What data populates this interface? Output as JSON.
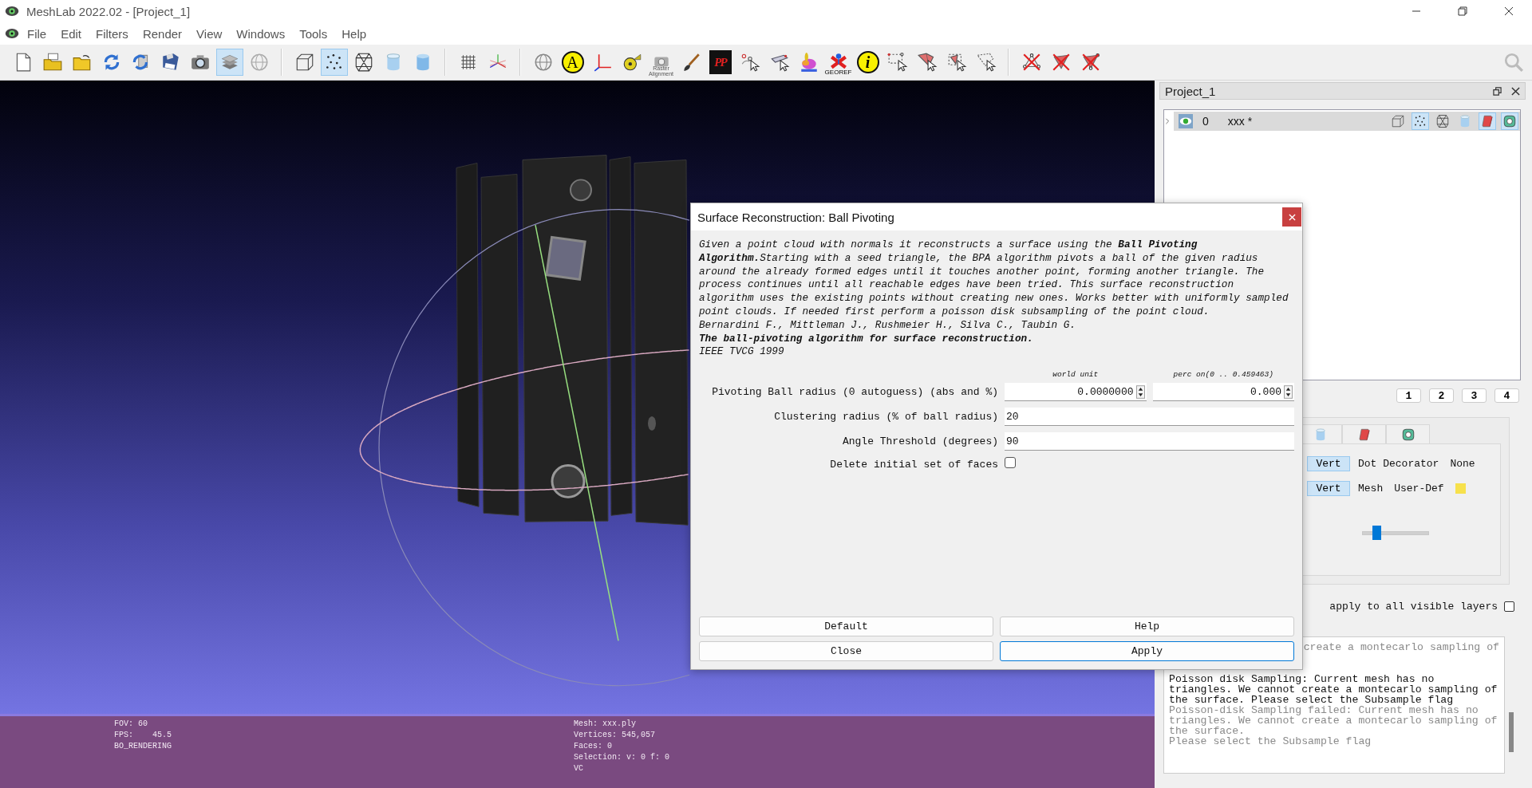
{
  "window": {
    "title": "MeshLab 2022.02 - [Project_1]"
  },
  "menu": [
    "File",
    "Edit",
    "Filters",
    "Render",
    "View",
    "Windows",
    "Tools",
    "Help"
  ],
  "toolbar": [
    [
      {
        "kind": "new-file",
        "selected": false
      },
      {
        "kind": "open-layers",
        "selected": false
      },
      {
        "kind": "open-folder",
        "selected": false
      },
      {
        "kind": "reload",
        "selected": false
      },
      {
        "kind": "reload-all",
        "selected": false
      },
      {
        "kind": "save",
        "selected": false
      },
      {
        "kind": "snapshot",
        "selected": false
      },
      {
        "kind": "layers",
        "selected": true
      },
      {
        "kind": "globe",
        "selected": false
      }
    ],
    [
      {
        "kind": "box",
        "selected": false
      },
      {
        "kind": "points",
        "selected": true
      },
      {
        "kind": "wireframe",
        "selected": false
      },
      {
        "kind": "cylinder",
        "selected": false
      },
      {
        "kind": "cylinder-flat",
        "selected": false
      }
    ],
    [
      {
        "kind": "grid",
        "selected": false
      },
      {
        "kind": "axes",
        "selected": false
      }
    ],
    [
      {
        "kind": "sphere",
        "selected": false
      },
      {
        "kind": "letter",
        "text": "A",
        "selected": false
      },
      {
        "kind": "axes-lines",
        "selected": false
      },
      {
        "kind": "tape",
        "selected": false
      },
      {
        "kind": "raster",
        "text": "Raster Alignment",
        "selected": false
      },
      {
        "kind": "brush",
        "selected": false
      },
      {
        "kind": "pp",
        "text": "PP",
        "selected": false
      },
      {
        "kind": "pick-points",
        "selected": false
      },
      {
        "kind": "pick-arrows",
        "selected": false
      },
      {
        "kind": "bunny",
        "selected": false
      },
      {
        "kind": "georef",
        "text": "GEOREF",
        "selected": false
      },
      {
        "kind": "info",
        "text": "i",
        "selected": false
      },
      {
        "kind": "select-rect",
        "selected": false
      },
      {
        "kind": "select-faces",
        "selected": false
      },
      {
        "kind": "select-conn",
        "selected": false
      },
      {
        "kind": "select-poly",
        "selected": false
      }
    ],
    [
      {
        "kind": "x-vertices",
        "selected": false
      },
      {
        "kind": "x-faces",
        "selected": false
      },
      {
        "kind": "x-both",
        "selected": false
      }
    ]
  ],
  "viewport": {
    "info_left": [
      "FOV: 60",
      "FPS:    45.5",
      "BO_RENDERING"
    ],
    "info_right": [
      "Mesh: xxx.ply",
      "Vertices: 545,057",
      "Faces: 0",
      "Selection: v: 0 f: 0",
      "VC"
    ]
  },
  "project_panel": {
    "title": "Project_1",
    "layers": [
      {
        "index": "0",
        "name": "xxx *",
        "visible": true,
        "expanded": false,
        "modes": [
          {
            "kind": "box",
            "selected": false
          },
          {
            "kind": "points",
            "selected": true
          },
          {
            "kind": "wireframe",
            "selected": false
          },
          {
            "kind": "cylinder",
            "selected": false
          },
          {
            "kind": "red-box",
            "selected": true
          },
          {
            "kind": "green-box",
            "selected": true
          }
        ]
      }
    ],
    "view_buttons": [
      "1",
      "2",
      "3",
      "4"
    ],
    "render_tabs": [
      {
        "kind": "cylinder"
      },
      {
        "kind": "red-box"
      },
      {
        "kind": "green-box"
      }
    ],
    "render_rows": [
      {
        "mode": "Vert",
        "label": "Dot Decorator",
        "value": "None"
      },
      {
        "mode": "Vert",
        "label": "Mesh",
        "value": "User-Def",
        "color": "#f7e14c"
      }
    ],
    "slider": {
      "level": 0.2
    },
    "apply_all": {
      "label": "apply to all visible layers",
      "checked": false
    }
  },
  "log": [
    {
      "text": "create a montecarlo sampling of",
      "kind": "faded"
    },
    {
      "text": "Poisson disk Sampling: Current mesh has no triangles. We cannot create a montecarlo sampling of the surface. Please select the Subsample flag",
      "kind": "normal"
    },
    {
      "text": "Poisson-disk Sampling failed: Current mesh has no triangles. We cannot create a montecarlo sampling of the surface.",
      "kind": "faded"
    },
    {
      "text": "Please select the Subsample flag",
      "kind": "faded"
    }
  ],
  "dialog": {
    "title": "Surface Reconstruction: Ball Pivoting",
    "description": [
      {
        "text": "Given a point cloud with normals it reconstructs a surface using the **Ball Pivoting Algorithm.**Starting with a seed triangle, the BPA algorithm pivots a ball of the given radius around the already formed edges until it touches another point, forming another triangle. The process continues until all reachable edges have been tried. This surface reconstruction algorithm uses the existing points without creating new ones. Works better with uniformly sampled point clouds. If needed first perform a poisson disk subsampling of the point cloud.",
        "bold": false
      },
      {
        "text": "Bernardini F., Mittleman J., Rushmeier H., Silva C., Taubin G.",
        "bold": false
      },
      {
        "text": "The ball-pivoting algorithm for surface reconstruction.",
        "bold": true
      },
      {
        "text": "IEEE TVCG 1999",
        "bold": false
      }
    ],
    "params": [
      {
        "kind": "abs_perc",
        "label": "Pivoting Ball radius (0 autoguess) (abs and %)",
        "unit_labels": [
          "world unit",
          "perc on(0 .. 0.459463)"
        ],
        "values": [
          "0.0000000",
          "0.000"
        ]
      },
      {
        "kind": "text",
        "label": "Clustering radius (% of ball radius)",
        "value": "20"
      },
      {
        "kind": "text",
        "label": "Angle Threshold (degrees)",
        "value": "90"
      },
      {
        "kind": "checkbox",
        "label": "Delete initial set of faces",
        "checked": false
      }
    ],
    "buttons": [
      {
        "label": "Default",
        "focused": false
      },
      {
        "label": "Help",
        "focused": false
      },
      {
        "label": "Close",
        "focused": false
      },
      {
        "label": "Apply",
        "focused": true
      }
    ]
  }
}
